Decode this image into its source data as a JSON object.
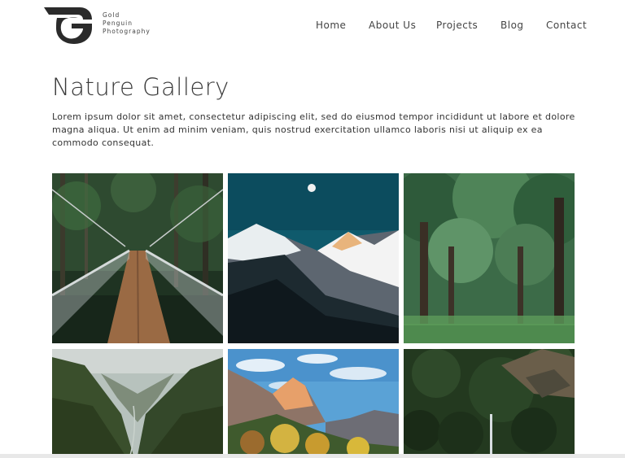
{
  "brand": {
    "lines": [
      "Gold",
      "Penguin",
      "Photography"
    ]
  },
  "nav": {
    "items": [
      "Home",
      "About Us",
      "Projects",
      "Blog",
      "Contact"
    ]
  },
  "hero": {
    "title": "Nature Gallery",
    "description": "Lorem ipsum dolor sit amet, consectetur adipiscing elit, sed do eiusmod tempor incididunt ut labore et dolore magna aliqua. Ut enim ad minim veniam, quis nostrud exercitation ullamco laboris nisi ut aliquip ex ea commodo consequat."
  },
  "gallery": {
    "images": [
      "suspension-bridge-forest",
      "moonlit-snowy-mountains",
      "green-tree-avenue",
      "misty-green-valley",
      "autumn-canyon-peaks",
      "forest-waterfall"
    ]
  }
}
